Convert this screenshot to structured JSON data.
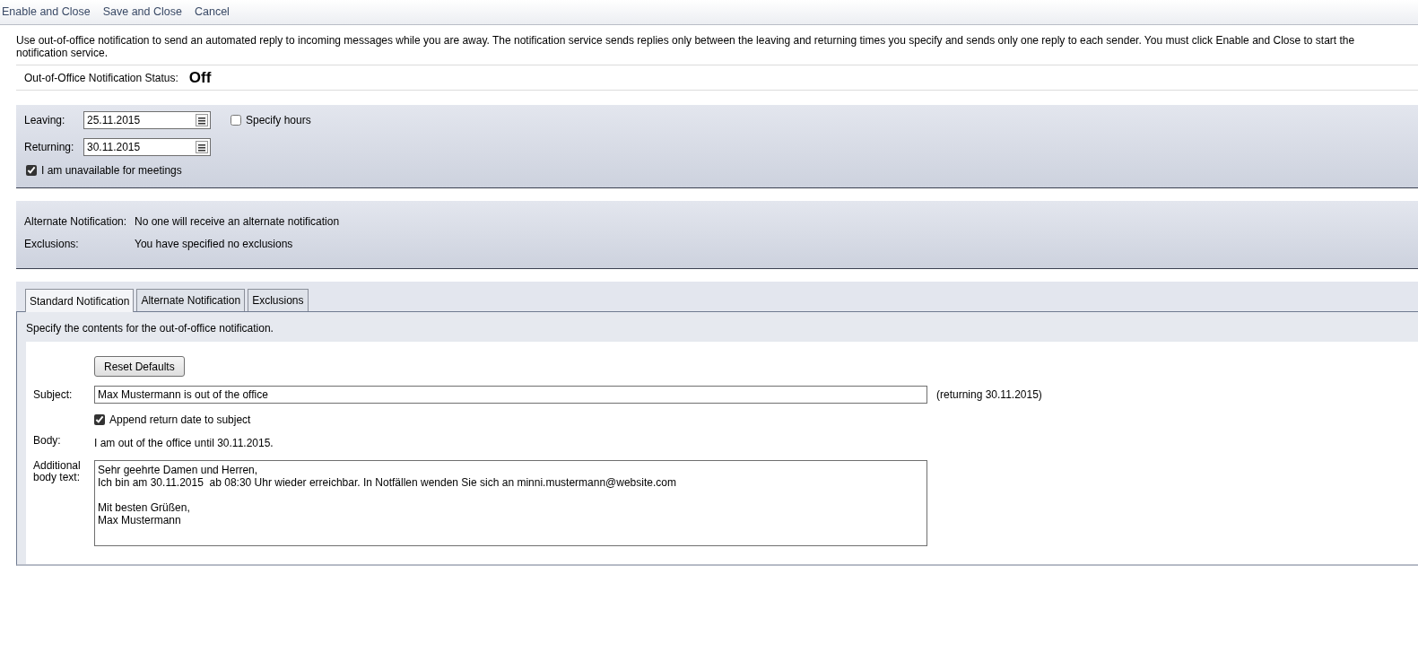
{
  "toolbar": [
    "Enable and Close",
    "Save and Close",
    "Cancel"
  ],
  "description": "Use out-of-office notification to send an automated reply to incoming messages while you are away. The notification service sends replies only between the leaving and returning times you specify and sends only one reply to each sender. You must click Enable and Close to start the notification service.",
  "status": {
    "label": "Out-of-Office Notification Status:",
    "value": "Off"
  },
  "dates": [
    {
      "label": "Leaving:",
      "value": "25.11.2015"
    },
    {
      "label": "Returning:",
      "value": "30.11.2015"
    }
  ],
  "specify_hours": {
    "label": "Specify hours",
    "checked": false
  },
  "unavailable": {
    "label": "I am unavailable for meetings",
    "checked": true
  },
  "summary": [
    {
      "label": "Alternate Notification:",
      "value": "No one will receive an alternate notification"
    },
    {
      "label": "Exclusions:",
      "value": "You have specified no exclusions"
    }
  ],
  "tabs": [
    {
      "label": "Standard Notification",
      "selected": true
    },
    {
      "label": "Alternate Notification",
      "selected": false
    },
    {
      "label": "Exclusions",
      "selected": false
    }
  ],
  "panel": {
    "intro": "Specify the contents for the out-of-office notification.",
    "reset_button": "Reset Defaults",
    "subject_label": "Subject:",
    "subject": "Max Mustermann is out of the office",
    "subject_suffix": "(returning 30.11.2015)",
    "append": {
      "label": "Append return date to subject",
      "checked": true
    },
    "body_label": "Body:",
    "body": "I am out of the office until 30.11.2015.",
    "additional_label": "Additional body text:",
    "additional_paragraphs": [
      [
        "Sehr geehrte Damen und Herren,",
        "Ich bin am 30.11.2015  ab 08:30 Uhr wieder erreichbar. In Notfällen wenden Sie sich an minni.mustermann@website.com"
      ],
      [
        "Mit besten Grüßen,",
        "Max Mustermann"
      ]
    ]
  }
}
